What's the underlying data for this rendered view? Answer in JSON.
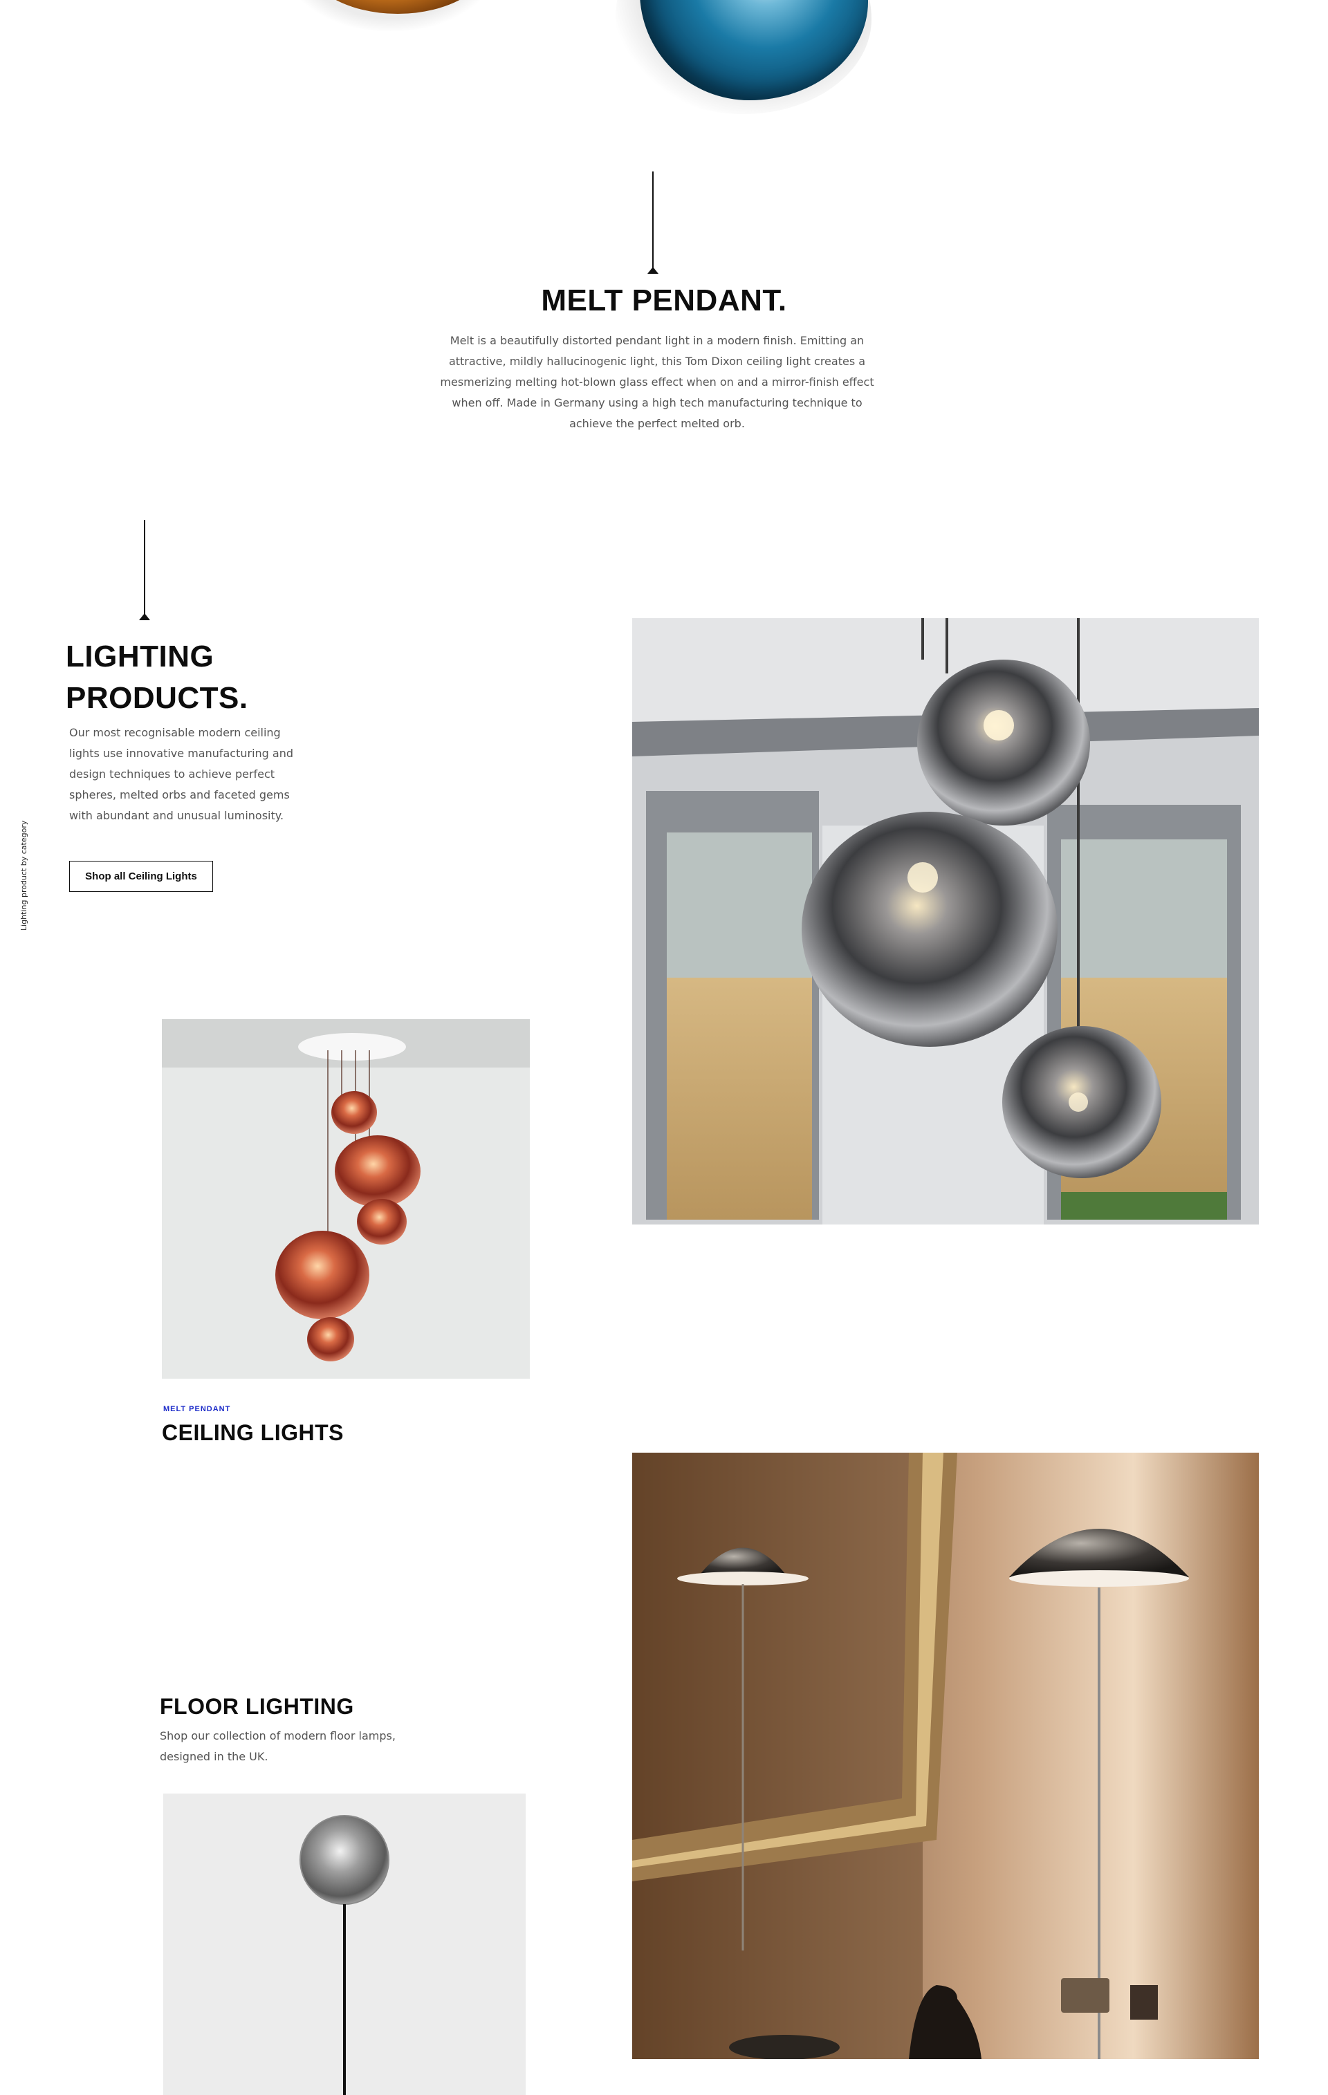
{
  "melt_section": {
    "title": "MELT PENDANT.",
    "description": "Melt is a beautifully distorted pendant light in a modern finish. Emitting an attractive, mildly hallucinogenic light, this Tom Dixon ceiling light creates a mesmerizing melting hot-blown glass effect when on and a mirror-finish effect when off. Made in Germany using a high tech manufacturing technique to achieve the perfect melted orb."
  },
  "lighting_products": {
    "title_line1": "LIGHTING",
    "title_line2": "PRODUCTS.",
    "description": "Our most recognisable modern ceiling lights use innovative manufacturing and design techniques to achieve perfect spheres, melted orbs and faceted gems with abundant and unusual luminosity.",
    "button_label": "Shop all Ceiling Lights",
    "side_label": "Lighting product by category"
  },
  "ceiling_card": {
    "eyebrow": "MELT PENDANT",
    "title": "CEILING LIGHTS"
  },
  "floor_card": {
    "title": "FLOOR LIGHTING",
    "description": "Shop our collection of modern floor lamps, designed in the UK."
  },
  "colors": {
    "text_primary": "#0d0d0d",
    "text_body": "#555555",
    "eyebrow_blue": "#1d2cc9",
    "background": "#ffffff"
  }
}
